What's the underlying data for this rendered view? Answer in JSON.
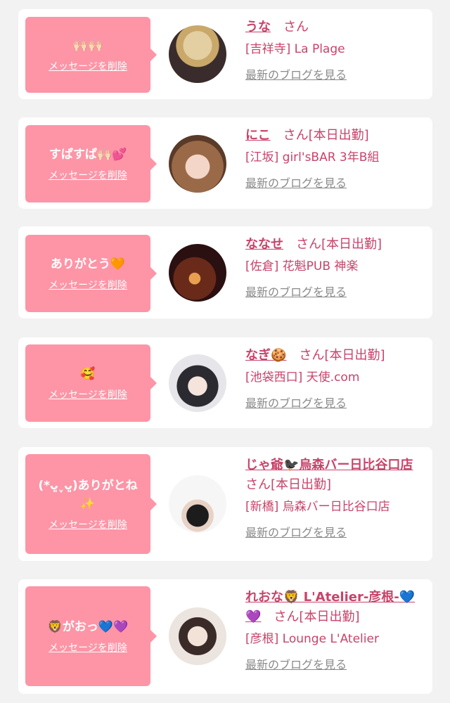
{
  "cards": [
    {
      "message": "🙌🏻🙌🏻",
      "delete_label": "メッセージを削除",
      "name": "うな",
      "san": "さん",
      "badge": "",
      "shop": "[吉祥寺] La Plage",
      "blog_label": "最新のブログを見る",
      "avatar_colors": [
        "#d8c39a",
        "#3a2a2a"
      ]
    },
    {
      "message": "すぱすぱ🙌🏻💕",
      "delete_label": "メッセージを削除",
      "name": "にこ",
      "san": "さん",
      "badge": "[本日出勤]",
      "shop": "[江坂] girl'sBAR 3年B組",
      "blog_label": "最新のブログを見る",
      "avatar_colors": [
        "#8a5a3a",
        "#f0d0c0"
      ]
    },
    {
      "message": "ありがとう🧡",
      "delete_label": "メッセージを削除",
      "name": "ななせ",
      "san": "さん",
      "badge": "[本日出勤]",
      "shop": "[佐倉] 花魁PUB 神楽",
      "blog_label": "最新のブログを見る",
      "avatar_colors": [
        "#4a1a1a",
        "#b03a2a"
      ]
    },
    {
      "message": "🥰",
      "delete_label": "メッセージを削除",
      "name": "なぎ🍪",
      "san": "さん",
      "badge": "[本日出勤]",
      "shop": "[池袋西口] 天使.com",
      "blog_label": "最新のブログを見る",
      "avatar_colors": [
        "#e8e8ec",
        "#2a2a30"
      ]
    },
    {
      "message": "(*ᴗ͈ˬᴗ͈)ありがとね✨",
      "delete_label": "メッセージを削除",
      "name": "じゃ爺🐦‍⬛烏森バー日比谷口店",
      "san": "さん",
      "badge": "[本日出勤]",
      "shop": "[新橋] 烏森バー日比谷口店",
      "blog_label": "最新のブログを見る",
      "avatar_colors": [
        "#f4f4f4",
        "#222222"
      ]
    },
    {
      "message": "🦁がおっ💙💜",
      "delete_label": "メッセージを削除",
      "name": "れおな🦁 L'Atelier-彦根-💙💜",
      "san": "さん",
      "badge": "[本日出勤]",
      "shop": "[彦根] Lounge L'Atelier",
      "blog_label": "最新のブログを見る",
      "avatar_colors": [
        "#3a2a28",
        "#f2ece6"
      ]
    }
  ]
}
